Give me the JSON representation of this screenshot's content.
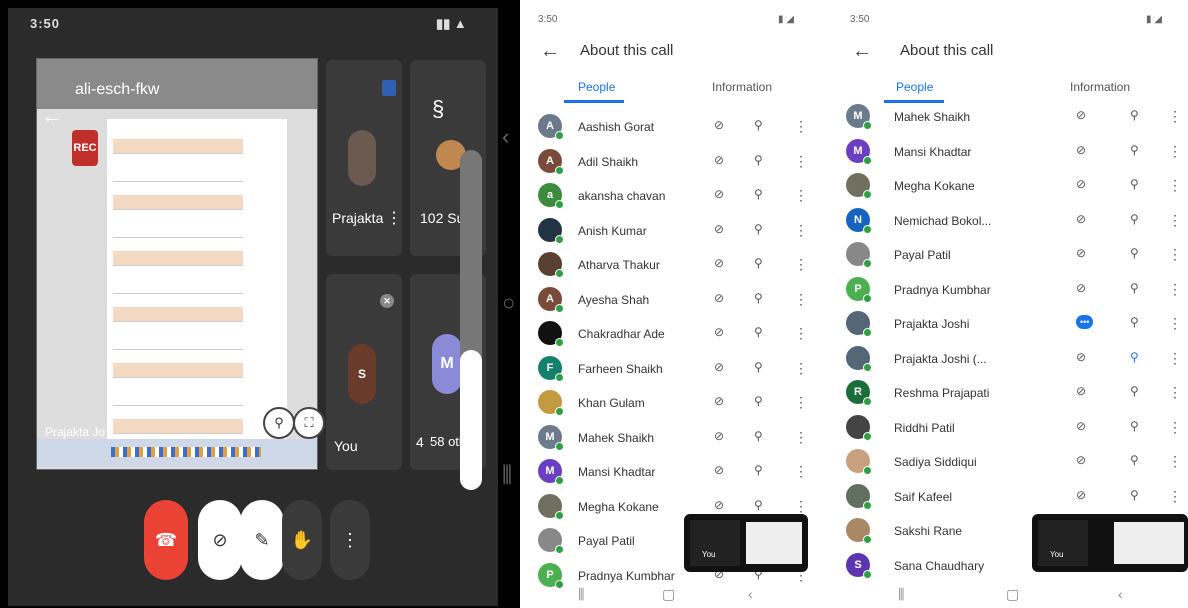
{
  "meet": {
    "status_left": "3:50",
    "status_right": "",
    "share_title": "ali-esch-fkw",
    "rec_label": "REC",
    "share_name": "Prajakta Jo",
    "tiles": [
      {
        "name": "Prajakta",
        "avatar": ""
      },
      {
        "name": "102 Su...",
        "avatar": ""
      },
      {
        "name": "You",
        "avatar": "S"
      },
      {
        "name": "58 oth",
        "avatar": "M",
        "count": "4"
      }
    ],
    "controls": [
      "end-call",
      "camera-off",
      "mic-off",
      "raise-hand",
      "more"
    ]
  },
  "phone1": {
    "status_time": "3:50",
    "title": "About this call",
    "tabs": [
      "People",
      "Information"
    ],
    "participants": [
      {
        "name": "Aashish Gorat",
        "initial": "A",
        "color": "#6b7b8c"
      },
      {
        "name": "Adil Shaikh",
        "initial": "A",
        "color": "#7a4a3a"
      },
      {
        "name": "akansha chavan",
        "initial": "a",
        "color": "#3d8b3d"
      },
      {
        "name": "Anish Kumar",
        "initial": "",
        "color": "#223344"
      },
      {
        "name": "Atharva Thakur",
        "initial": "",
        "color": "#5a4030"
      },
      {
        "name": "Ayesha Shah",
        "initial": "A",
        "color": "#7a4a3a"
      },
      {
        "name": "Chakradhar Ade",
        "initial": "",
        "color": "#111111"
      },
      {
        "name": "Farheen Shaikh",
        "initial": "F",
        "color": "#12806a"
      },
      {
        "name": "Khan Gulam",
        "initial": "",
        "color": "#c49a40"
      },
      {
        "name": "Mahek Shaikh",
        "initial": "M",
        "color": "#6b7b8c"
      },
      {
        "name": "Mansi Khadtar",
        "initial": "M",
        "color": "#6a3fc2"
      },
      {
        "name": "Megha Kokane",
        "initial": "",
        "color": "#707060"
      },
      {
        "name": "Payal Patil",
        "initial": "",
        "color": "#888888"
      },
      {
        "name": "Pradnya Kumbhar",
        "initial": "P",
        "color": "#4caf50"
      }
    ],
    "mini_label": "You"
  },
  "phone2": {
    "status_time": "3:50",
    "title": "About this call",
    "tabs": [
      "People",
      "Information"
    ],
    "participants": [
      {
        "name": "Mahek Shaikh",
        "initial": "M",
        "color": "#6b7b8c"
      },
      {
        "name": "Mansi Khadtar",
        "initial": "M",
        "color": "#6a3fc2"
      },
      {
        "name": "Megha Kokane",
        "initial": "",
        "color": "#707060"
      },
      {
        "name": "Nemichad Bokol...",
        "initial": "N",
        "color": "#1565c0"
      },
      {
        "name": "Payal Patil",
        "initial": "",
        "color": "#888888"
      },
      {
        "name": "Pradnya Kumbhar",
        "initial": "P",
        "color": "#4caf50"
      },
      {
        "name": "Prajakta Joshi",
        "initial": "",
        "color": "#556677",
        "speaking": true
      },
      {
        "name": "Prajakta Joshi (...",
        "initial": "",
        "color": "#556677",
        "pinned": true
      },
      {
        "name": "Reshma Prajapati",
        "initial": "R",
        "color": "#1b6e3a"
      },
      {
        "name": "Riddhi Patil",
        "initial": "",
        "color": "#444444"
      },
      {
        "name": "Sadiya Siddiqui",
        "initial": "",
        "color": "#c8a080"
      },
      {
        "name": "Saif Kafeel",
        "initial": "",
        "color": "#607060"
      },
      {
        "name": "Sakshi Rane",
        "initial": "",
        "color": "#aa8866"
      },
      {
        "name": "Sana Chaudhary",
        "initial": "S",
        "color": "#5e35b1"
      }
    ],
    "mini_label": "You"
  }
}
